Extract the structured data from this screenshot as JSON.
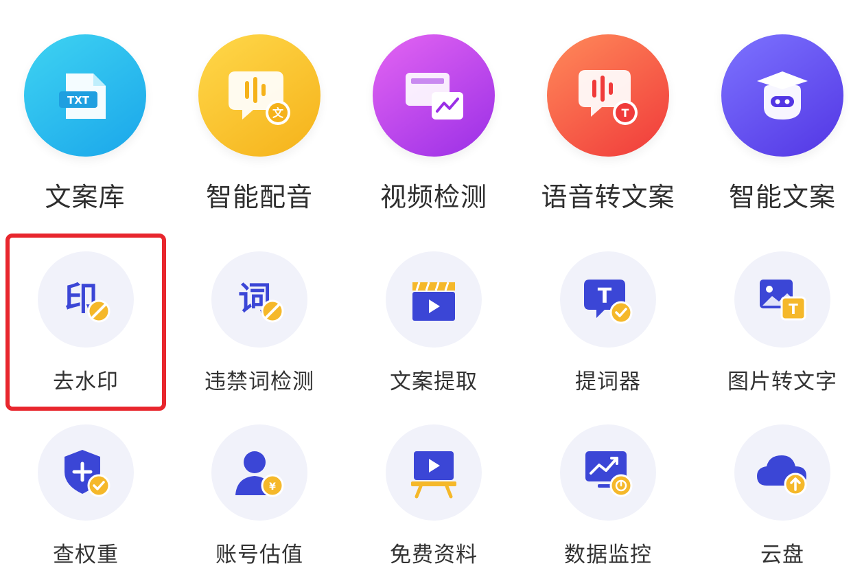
{
  "colors": {
    "brand_blue": "#3b46d6",
    "badge_gold": "#f5b82a",
    "highlight_red": "#e8262d"
  },
  "row1": [
    {
      "label": "文案库",
      "icon": "txt-file-icon",
      "color": "blue"
    },
    {
      "label": "智能配音",
      "icon": "voice-bubble-icon",
      "color": "yellow"
    },
    {
      "label": "视频检测",
      "icon": "video-chart-icon",
      "color": "purple"
    },
    {
      "label": "语音转文案",
      "icon": "speech-to-text-icon",
      "color": "red"
    },
    {
      "label": "智能文案",
      "icon": "robot-scholar-icon",
      "color": "indigo"
    }
  ],
  "row2": [
    {
      "label": "去水印",
      "icon": "remove-watermark-icon"
    },
    {
      "label": "违禁词检测",
      "icon": "banned-word-icon"
    },
    {
      "label": "文案提取",
      "icon": "clapperboard-icon"
    },
    {
      "label": "提词器",
      "icon": "teleprompter-icon"
    },
    {
      "label": "图片转文字",
      "icon": "image-to-text-icon"
    }
  ],
  "row3": [
    {
      "label": "查权重",
      "icon": "shield-plus-icon"
    },
    {
      "label": "账号估值",
      "icon": "account-value-icon"
    },
    {
      "label": "免费资料",
      "icon": "presentation-icon"
    },
    {
      "label": "数据监控",
      "icon": "monitor-trend-icon"
    },
    {
      "label": "云盘",
      "icon": "cloud-upload-icon"
    }
  ],
  "icon_text": {
    "txt": "TXT",
    "yin": "印",
    "ci": "词",
    "wen": "文",
    "t": "T"
  }
}
